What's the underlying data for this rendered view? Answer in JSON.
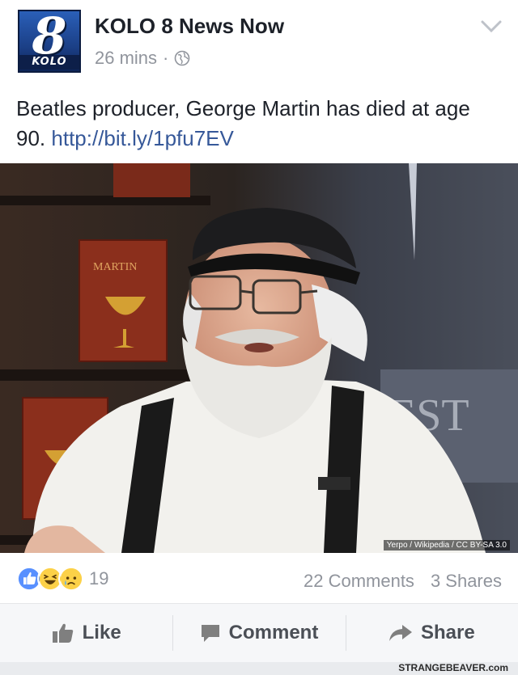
{
  "post": {
    "page_name": "KOLO 8 News Now",
    "logo_number": "8",
    "logo_wordmark": "KOLO",
    "time": "26 mins",
    "separator": "·",
    "privacy_icon": "globe-icon",
    "menu_icon": "chevron-down-icon",
    "text": "Beatles producer, George Martin has died at age 90.",
    "link": "http://bit.ly/1pfu7EV"
  },
  "photo": {
    "book_title": "MARTIN",
    "credit": "Yerpo / Wikipedia / CC BY-SA 3.0"
  },
  "stats": {
    "reaction_icons": [
      "like-reaction-icon",
      "haha-reaction-icon",
      "sad-reaction-icon"
    ],
    "reaction_count": "19",
    "comments": "22 Comments",
    "shares": "3 Shares"
  },
  "actions": {
    "like": "Like",
    "comment": "Comment",
    "share": "Share"
  },
  "watermark": "STRANGEBEAVER.com",
  "colors": {
    "link": "#365899",
    "secondary_text": "#90949c",
    "like_blue": "#5890ff",
    "haha_yellow": "#fcd148"
  }
}
